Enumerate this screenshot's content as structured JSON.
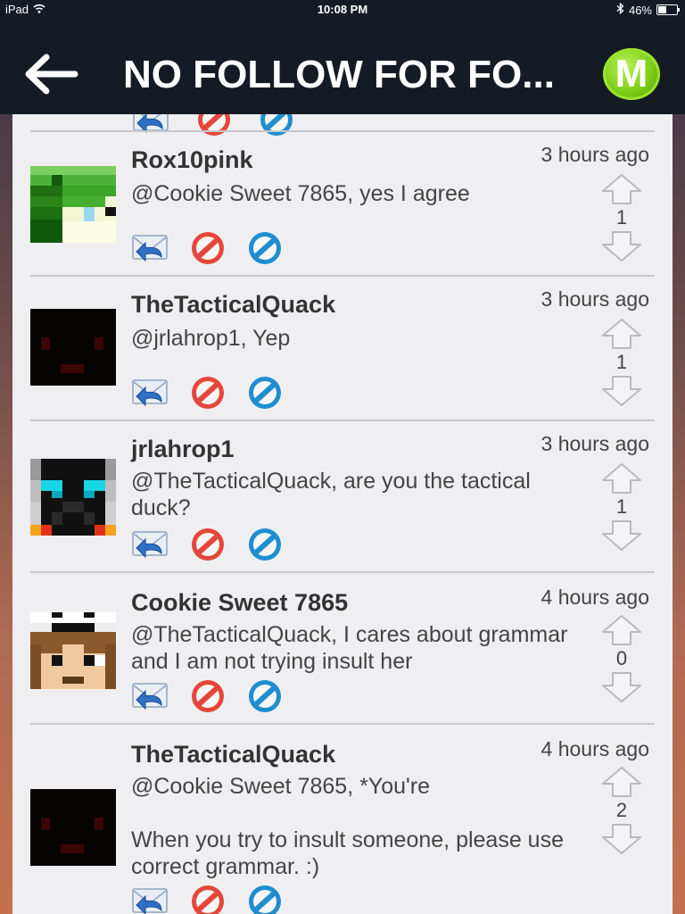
{
  "status_bar": {
    "device": "iPad",
    "time": "10:08 PM",
    "battery": "46%",
    "battery_level": 0.46
  },
  "nav": {
    "title": "NO FOLLOW FOR FO...",
    "logo_letter": "M"
  },
  "comments": [
    {
      "username": "Rox10pink",
      "time": "3 hours ago",
      "text": "@Cookie Sweet 7865, yes I agree",
      "votes": "1"
    },
    {
      "username": "TheTacticalQuack",
      "time": "3 hours ago",
      "text": "@jrlahrop1, Yep",
      "votes": "1"
    },
    {
      "username": "jrlahrop1",
      "time": "3 hours ago",
      "text": "@TheTacticalQuack, are you the tactical duck?",
      "votes": "1"
    },
    {
      "username": "Cookie Sweet 7865",
      "time": "4 hours ago",
      "text": "@TheTacticalQuack, I cares about grammar and I am not trying insult her",
      "votes": "0"
    },
    {
      "username": "TheTacticalQuack",
      "time": "4 hours ago",
      "text": "@Cookie Sweet 7865, *You're\n\nWhen you try to insult someone, please use correct grammar. :)",
      "votes": "2"
    }
  ]
}
